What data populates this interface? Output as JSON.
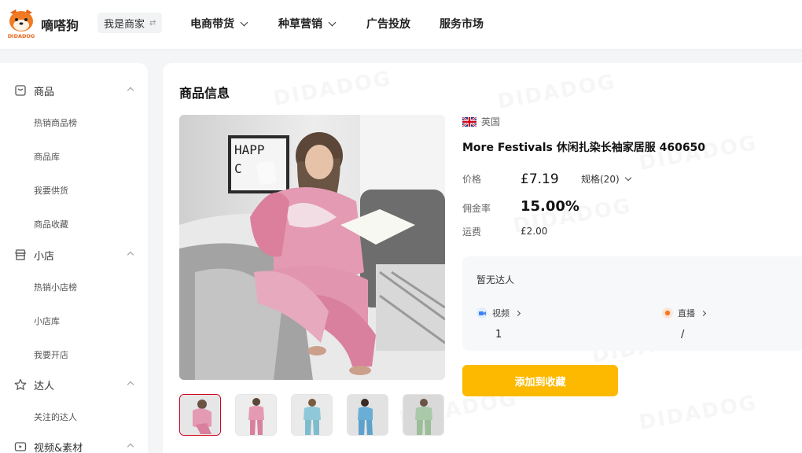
{
  "brand": {
    "name": "嘀嗒狗",
    "logo_sub": "DIDADOG"
  },
  "role_switch": {
    "label": "我是商家",
    "icon": "swap-icon"
  },
  "nav": [
    {
      "label": "电商带货",
      "has_dropdown": true
    },
    {
      "label": "种草营销",
      "has_dropdown": true
    },
    {
      "label": "广告投放",
      "has_dropdown": false
    },
    {
      "label": "服务市场",
      "has_dropdown": false
    }
  ],
  "sidebar": {
    "groups": [
      {
        "label": "商品",
        "icon": "shopping-bag-icon",
        "items": [
          "热销商品榜",
          "商品库",
          "我要供货",
          "商品收藏"
        ]
      },
      {
        "label": "小店",
        "icon": "store-icon",
        "items": [
          "热销小店榜",
          "小店库",
          "我要开店"
        ]
      },
      {
        "label": "达人",
        "icon": "star-icon",
        "items": [
          "关注的达人"
        ]
      },
      {
        "label": "视频&素材",
        "icon": "video-icon",
        "items": []
      }
    ]
  },
  "watermark": "DIDADOG",
  "main": {
    "section_title": "商品信息",
    "product": {
      "country": "英国",
      "country_flag": "uk-flag-icon",
      "title": "More Festivals 休闲扎染长袖家居服 460650",
      "price_label": "价格",
      "price": "£7.19",
      "spec": "规格(20)",
      "commission_label": "佣金率",
      "commission": "15.00%",
      "shipping_label": "运费",
      "shipping": "£2.00"
    },
    "talent": {
      "title": "暂无达人",
      "video_label": "视频",
      "video_value": "1",
      "live_label": "直播",
      "live_value": "/"
    },
    "favorite_button": "添加到收藏",
    "accent_color": "#fcb900",
    "thumbnails": [
      "pink tie-dye",
      "pink tie-dye (front)",
      "blue tie-dye",
      "blue tie-dye (side)",
      "green tie-dye"
    ]
  }
}
